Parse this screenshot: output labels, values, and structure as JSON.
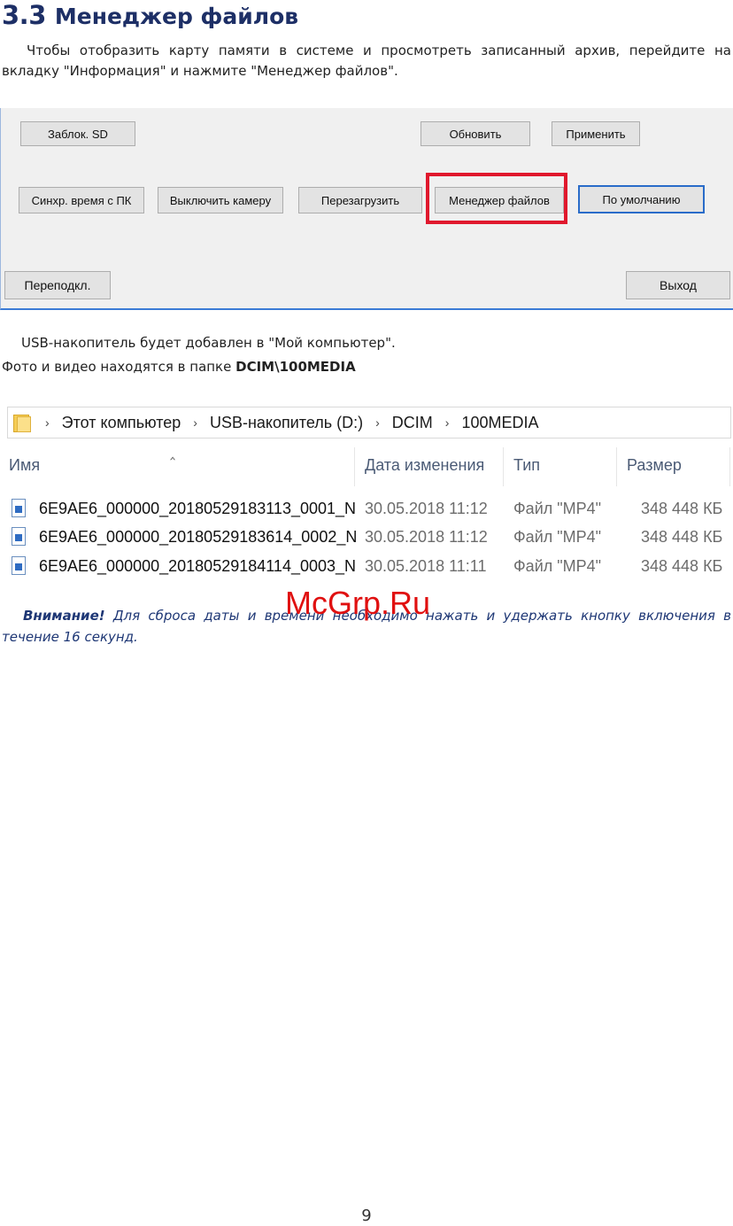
{
  "heading": {
    "number": "3.3",
    "title": "Менеджер файлов"
  },
  "intro": "Чтобы отобразить карту памяти в системе и просмотреть записанный архив, перейдите на вкладку \"Информация\" и нажмите \"Менеджер файлов\".",
  "dialog": {
    "buttons": {
      "lock_sd": "Заблок. SD",
      "refresh": "Обновить",
      "apply": "Применить",
      "sync_time": "Синхр. время с ПК",
      "camera_off": "Выключить камеру",
      "reboot": "Перезагрузить",
      "file_manager": "Менеджер файлов",
      "default": "По умолчанию",
      "reconnect": "Переподкл.",
      "exit": "Выход"
    },
    "highlight_color": "#e0182d"
  },
  "usb_text": "USB-накопитель будет добавлен в \"Мой компьютер\".",
  "path_text": {
    "prefix": "Фото и видео находятся в папке ",
    "path": "DCIM\\100MEDIA"
  },
  "explorer": {
    "breadcrumb": [
      "Этот компьютер",
      "USB-накопитель (D:)",
      "DCIM",
      "100MEDIA"
    ],
    "columns": {
      "name": "Имя",
      "date": "Дата изменения",
      "type": "Тип",
      "size": "Размер"
    },
    "files": [
      {
        "name": "6E9AE6_000000_20180529183113_0001_N",
        "date": "30.05.2018 11:12",
        "type": "Файл \"MP4\"",
        "size": "348 448 КБ"
      },
      {
        "name": "6E9AE6_000000_20180529183614_0002_N",
        "date": "30.05.2018 11:12",
        "type": "Файл \"MP4\"",
        "size": "348 448 КБ"
      },
      {
        "name": "6E9AE6_000000_20180529184114_0003_N",
        "date": "30.05.2018 11:11",
        "type": "Файл \"MP4\"",
        "size": "348 448 КБ"
      }
    ]
  },
  "warning": {
    "label": "Внимание!",
    "text": " Для сброса даты и времени необходимо нажать и удержать кнопку включения в течение 16 секунд."
  },
  "watermark": "McGrp.Ru",
  "page_number": "9"
}
